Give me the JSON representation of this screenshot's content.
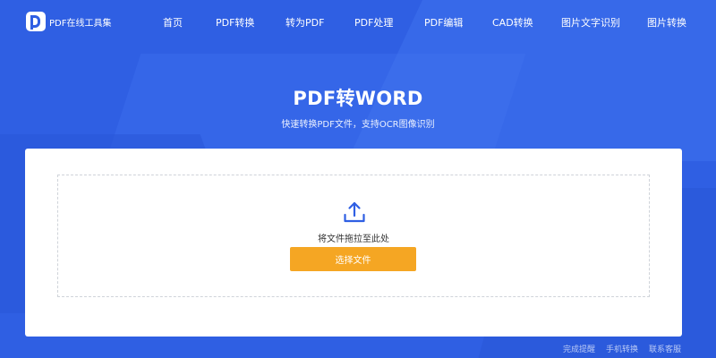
{
  "logo": {
    "text": "PDF在线工具集",
    "icon": "pdf-d-logo-icon"
  },
  "nav": {
    "items": [
      {
        "label": "首页"
      },
      {
        "label": "PDF转换"
      },
      {
        "label": "转为PDF"
      },
      {
        "label": "PDF处理"
      },
      {
        "label": "PDF编辑"
      },
      {
        "label": "CAD转换"
      },
      {
        "label": "图片文字识别"
      },
      {
        "label": "图片转换"
      }
    ]
  },
  "hero": {
    "title": "PDF转WORD",
    "subtitle": "快速转换PDF文件，支持OCR图像识别"
  },
  "upload": {
    "icon": "upload-icon",
    "drop_text": "将文件拖拉至此处",
    "select_button": "选择文件"
  },
  "footer": {
    "links": [
      {
        "label": "完成提醒"
      },
      {
        "label": "手机转换"
      },
      {
        "label": "联系客服"
      }
    ]
  },
  "colors": {
    "background": "#2f5fe3",
    "button": "#f5a623",
    "upload_icon": "#2f5fe3"
  }
}
